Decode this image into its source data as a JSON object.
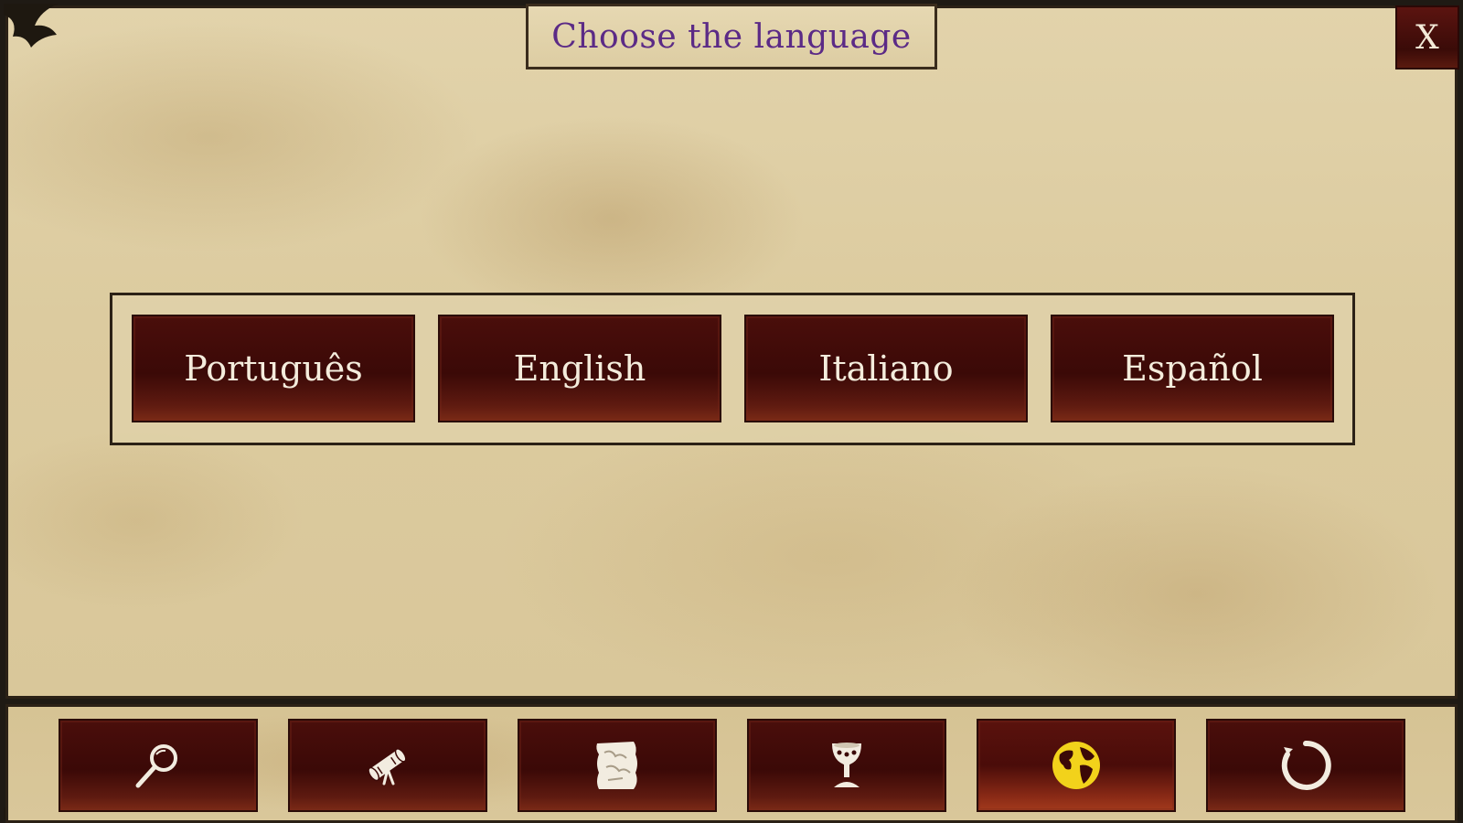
{
  "dialog": {
    "title": "Choose the language",
    "close_label": "X"
  },
  "languages": [
    {
      "label": "Português"
    },
    {
      "label": "English"
    },
    {
      "label": "Italiano"
    },
    {
      "label": "Español"
    }
  ],
  "bottom_nav": [
    {
      "icon": "magnifier-icon"
    },
    {
      "icon": "scroll-icon"
    },
    {
      "icon": "map-icon"
    },
    {
      "icon": "chalice-icon"
    },
    {
      "icon": "globe-icon",
      "active": true
    },
    {
      "icon": "ouroboros-icon"
    }
  ],
  "colors": {
    "parchment": "#dccb9f",
    "button_red": "#3b0907",
    "title_purple": "#5b2a86",
    "active_icon_yellow": "#f2d21b",
    "label_white": "#f4ecdc"
  }
}
